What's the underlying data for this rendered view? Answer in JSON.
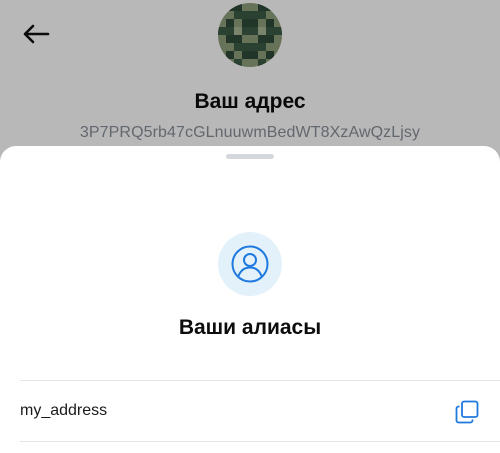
{
  "header": {
    "back_icon": "arrow-left-icon",
    "title": "Ваш адрес",
    "address": "3P7PRQ5rb47cGLnuuwmBedWT8XzAwQzLjsy"
  },
  "sheet": {
    "icon": "user-circle-icon",
    "title": "Ваши алиасы",
    "aliases": [
      {
        "name": "my_address",
        "action_icon": "copy-icon"
      }
    ]
  },
  "colors": {
    "accent": "#1f7ae0",
    "icon_bg": "#e3f1fb",
    "muted_text": "#8a9099",
    "divider": "#e3e5e8",
    "scrim": "rgba(0,0,0,0.28)"
  }
}
